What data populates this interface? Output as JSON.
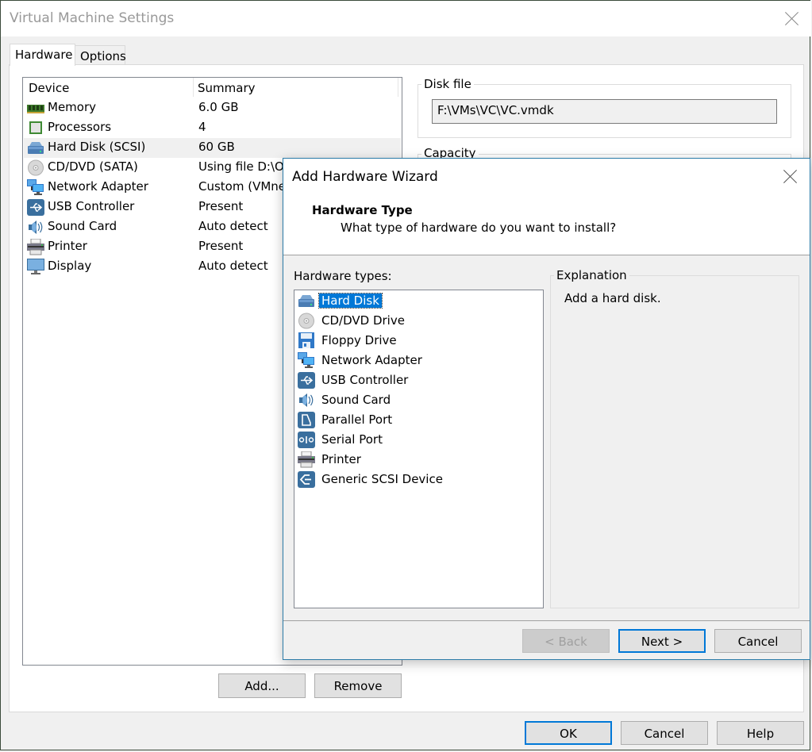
{
  "main_window": {
    "title": "Virtual Machine Settings",
    "tabs": [
      {
        "label": "Hardware",
        "active": true
      },
      {
        "label": "Options",
        "active": false
      }
    ],
    "device_list": {
      "columns": [
        "Device",
        "Summary"
      ],
      "rows": [
        {
          "icon": "memory-icon",
          "device": "Memory",
          "summary": "6.0 GB",
          "selected": false
        },
        {
          "icon": "processor-icon",
          "device": "Processors",
          "summary": "4",
          "selected": false
        },
        {
          "icon": "hard-disk-icon",
          "device": "Hard Disk (SCSI)",
          "summary": "60 GB",
          "selected": true
        },
        {
          "icon": "cd-dvd-icon",
          "device": "CD/DVD (SATA)",
          "summary": "Using file D:\\O",
          "selected": false
        },
        {
          "icon": "network-adapter-icon",
          "device": "Network Adapter",
          "summary": "Custom (VMnet",
          "selected": false
        },
        {
          "icon": "usb-icon",
          "device": "USB Controller",
          "summary": "Present",
          "selected": false
        },
        {
          "icon": "sound-card-icon",
          "device": "Sound Card",
          "summary": "Auto detect",
          "selected": false
        },
        {
          "icon": "printer-icon",
          "device": "Printer",
          "summary": "Present",
          "selected": false
        },
        {
          "icon": "display-icon",
          "device": "Display",
          "summary": "Auto detect",
          "selected": false
        }
      ]
    },
    "buttons": {
      "add": "Add...",
      "remove": "Remove",
      "ok": "OK",
      "cancel": "Cancel",
      "help": "Help"
    },
    "disk_file": {
      "label": "Disk file",
      "value": "F:\\VMs\\VC\\VC.vmdk"
    },
    "capacity": {
      "label": "Capacity"
    }
  },
  "wizard": {
    "title": "Add Hardware Wizard",
    "heading": "Hardware Type",
    "subheading": "What type of hardware do you want to install?",
    "hardware_types_label": "Hardware types:",
    "hardware_types": [
      {
        "icon": "hard-disk-icon",
        "label": "Hard Disk",
        "selected": true
      },
      {
        "icon": "cd-dvd-icon",
        "label": "CD/DVD Drive",
        "selected": false
      },
      {
        "icon": "floppy-icon",
        "label": "Floppy Drive",
        "selected": false
      },
      {
        "icon": "network-adapter-icon",
        "label": "Network Adapter",
        "selected": false
      },
      {
        "icon": "usb-icon",
        "label": "USB Controller",
        "selected": false
      },
      {
        "icon": "sound-card-icon",
        "label": "Sound Card",
        "selected": false
      },
      {
        "icon": "parallel-port-icon",
        "label": "Parallel Port",
        "selected": false
      },
      {
        "icon": "serial-port-icon",
        "label": "Serial Port",
        "selected": false
      },
      {
        "icon": "printer-icon",
        "label": "Printer",
        "selected": false
      },
      {
        "icon": "generic-scsi-icon",
        "label": "Generic SCSI Device",
        "selected": false
      }
    ],
    "explanation_label": "Explanation",
    "explanation_text": "Add a hard disk.",
    "buttons": {
      "back": "< Back",
      "next": "Next >",
      "cancel": "Cancel"
    }
  },
  "colors": {
    "accent": "#0078d7",
    "selection": "#0078d7",
    "window_bg": "#f0f0f0",
    "panel_bg": "#ffffff",
    "icon_blue": "#3a6f9e"
  }
}
